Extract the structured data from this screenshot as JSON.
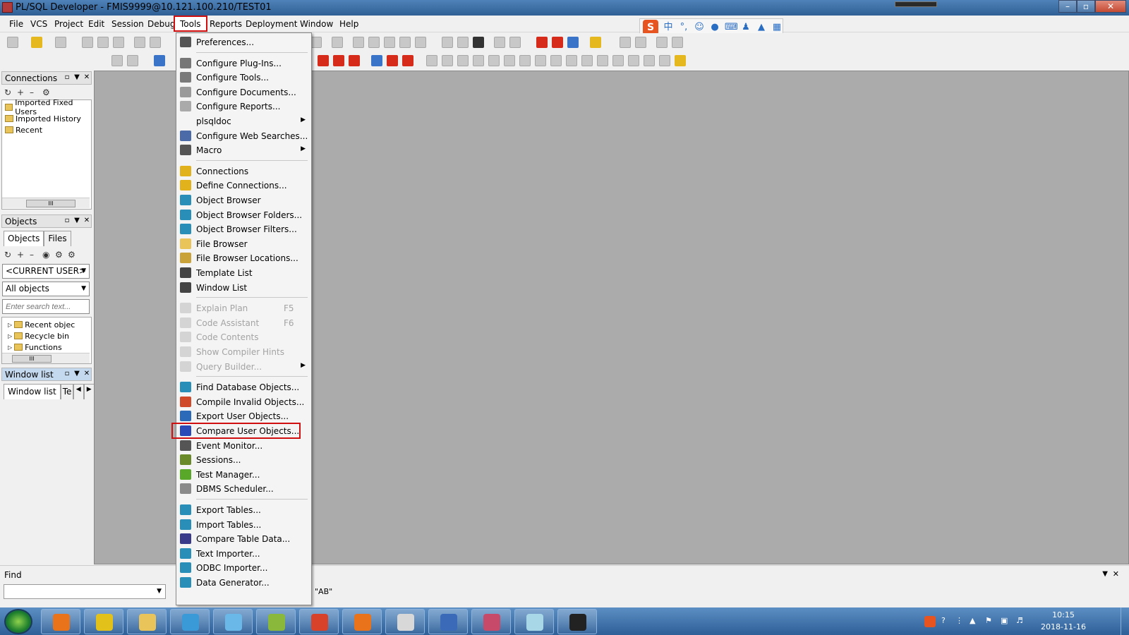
{
  "window": {
    "title": "PL/SQL Developer - FMIS9999@10.121.100.210/TEST01"
  },
  "menubar": [
    {
      "label": "File"
    },
    {
      "label": "VCS"
    },
    {
      "label": "Project"
    },
    {
      "label": "Edit"
    },
    {
      "label": "Session"
    },
    {
      "label": "Debug"
    },
    {
      "label": "Tools"
    },
    {
      "label": "Reports"
    },
    {
      "label": "Deployment"
    },
    {
      "label": "Window"
    },
    {
      "label": "Help"
    }
  ],
  "ime": {
    "logo": "S",
    "chinese": "中"
  },
  "panels": {
    "connections": {
      "title": "Connections",
      "items": [
        "Imported Fixed Users",
        "Imported History",
        "Recent"
      ]
    },
    "objects": {
      "title": "Objects",
      "tabs": [
        "Objects",
        "Files"
      ],
      "user_combo": "<CURRENT USER>",
      "filter_combo": "All objects",
      "search_placeholder": "Enter search text...",
      "tree": [
        "Recent objec",
        "Recycle bin",
        "Functions"
      ]
    },
    "window_list": {
      "title": "Window list",
      "tabs": [
        "Window list",
        "Te"
      ]
    }
  },
  "find": {
    "label": "Find",
    "hint": "\"AB\""
  },
  "tools_menu": {
    "items": [
      {
        "label": "Preferences...",
        "icon": "wrench-icon",
        "color": "#555555"
      },
      {
        "sep": true
      },
      {
        "label": "Configure Plug-Ins...",
        "icon": "plugin-icon",
        "color": "#777777"
      },
      {
        "label": "Configure Tools...",
        "icon": "tools-icon",
        "color": "#7a7a7a"
      },
      {
        "label": "Configure Documents...",
        "icon": "documents-icon",
        "color": "#9a9a9a"
      },
      {
        "label": "Configure Reports...",
        "icon": "reports-icon",
        "color": "#aaaaaa"
      },
      {
        "label": "plsqldoc",
        "submenu": true
      },
      {
        "label": "Configure Web Searches...",
        "icon": "web-search-icon",
        "color": "#4a6aa8"
      },
      {
        "label": "Macro",
        "icon": "macro-icon",
        "color": "#555555",
        "submenu": true
      },
      {
        "sep": true
      },
      {
        "label": "Connections",
        "icon": "connections-icon",
        "color": "#e2b21c"
      },
      {
        "label": "Define Connections...",
        "icon": "define-connections-icon",
        "color": "#e2b21c"
      },
      {
        "label": "Object Browser",
        "icon": "object-browser-icon",
        "color": "#2a8fb8"
      },
      {
        "label": "Object Browser Folders...",
        "icon": "folders-icon",
        "color": "#2a8fb8"
      },
      {
        "label": "Object Browser Filters...",
        "icon": "filters-icon",
        "color": "#2a8fb8"
      },
      {
        "label": "File Browser",
        "icon": "file-browser-icon",
        "color": "#e8c45a"
      },
      {
        "label": "File Browser Locations...",
        "icon": "locations-icon",
        "color": "#c9a23a"
      },
      {
        "label": "Template List",
        "icon": "template-icon",
        "color": "#444444"
      },
      {
        "label": "Window List",
        "icon": "window-list-icon",
        "color": "#444444"
      },
      {
        "sep": true
      },
      {
        "label": "Explain Plan",
        "shortcut": "F5",
        "icon": "explain-plan-icon",
        "color": "#999999",
        "disabled": true
      },
      {
        "label": "Code Assistant",
        "shortcut": "F6",
        "icon": "code-assistant-icon",
        "color": "#999999",
        "disabled": true
      },
      {
        "label": "Code Contents",
        "icon": "code-contents-icon",
        "color": "#999999",
        "disabled": true
      },
      {
        "label": "Show Compiler Hints",
        "icon": "compiler-hints-icon",
        "color": "#999999",
        "disabled": true
      },
      {
        "label": "Query Builder...",
        "icon": "query-builder-icon",
        "color": "#999999",
        "disabled": true,
        "submenu": true
      },
      {
        "sep": true
      },
      {
        "label": "Find Database Objects...",
        "icon": "find-objects-icon",
        "color": "#2a8fb8"
      },
      {
        "label": "Compile Invalid Objects...",
        "icon": "compile-icon",
        "color": "#d04a2a"
      },
      {
        "label": "Export User Objects...",
        "icon": "export-objects-icon",
        "color": "#2a6ab8"
      },
      {
        "label": "Compare User Objects...",
        "icon": "compare-objects-icon",
        "color": "#2a4ab8",
        "highlighted": true
      },
      {
        "label": "Event Monitor...",
        "icon": "event-monitor-icon",
        "color": "#555555"
      },
      {
        "label": "Sessions...",
        "icon": "sessions-icon",
        "color": "#6a8a2a"
      },
      {
        "label": "Test Manager...",
        "icon": "test-manager-icon",
        "color": "#5aa82a"
      },
      {
        "label": "DBMS Scheduler...",
        "icon": "scheduler-icon",
        "color": "#8a8a8a"
      },
      {
        "sep": true
      },
      {
        "label": "Export Tables...",
        "icon": "export-tables-icon",
        "color": "#2a8fb8"
      },
      {
        "label": "Import Tables...",
        "icon": "import-tables-icon",
        "color": "#2a8fb8"
      },
      {
        "label": "Compare Table Data...",
        "icon": "compare-table-icon",
        "color": "#3a3a8a"
      },
      {
        "label": "Text Importer...",
        "icon": "text-importer-icon",
        "color": "#2a8fb8"
      },
      {
        "label": "ODBC Importer...",
        "icon": "odbc-importer-icon",
        "color": "#2a8fb8"
      },
      {
        "label": "Data Generator...",
        "icon": "data-generator-icon",
        "color": "#2a8fb8"
      }
    ]
  },
  "taskbar": {
    "apps": [
      {
        "icon": "media-player-icon",
        "color": "#e8731a"
      },
      {
        "icon": "ultraedit-icon",
        "color": "#e2c21a"
      },
      {
        "icon": "explorer-icon",
        "color": "#e8c45a"
      },
      {
        "icon": "app-cloud-icon",
        "color": "#3a9ad8"
      },
      {
        "icon": "contacts-icon",
        "color": "#6ab8e8"
      },
      {
        "icon": "chart-app-icon",
        "color": "#8ab83a"
      },
      {
        "icon": "chrome-icon",
        "color": "#d8422a"
      },
      {
        "icon": "firefox-icon",
        "color": "#e8731a"
      },
      {
        "icon": "window-app-icon",
        "color": "#d8d8d8"
      },
      {
        "icon": "network-icon",
        "color": "#3a6ab8"
      },
      {
        "icon": "database-app-icon",
        "color": "#c84a6a"
      },
      {
        "icon": "notes-app-icon",
        "color": "#a8d8e8"
      },
      {
        "icon": "eye-app-icon",
        "color": "#222222"
      }
    ],
    "clock": {
      "time": "10:15",
      "date": "2018-11-16"
    }
  }
}
